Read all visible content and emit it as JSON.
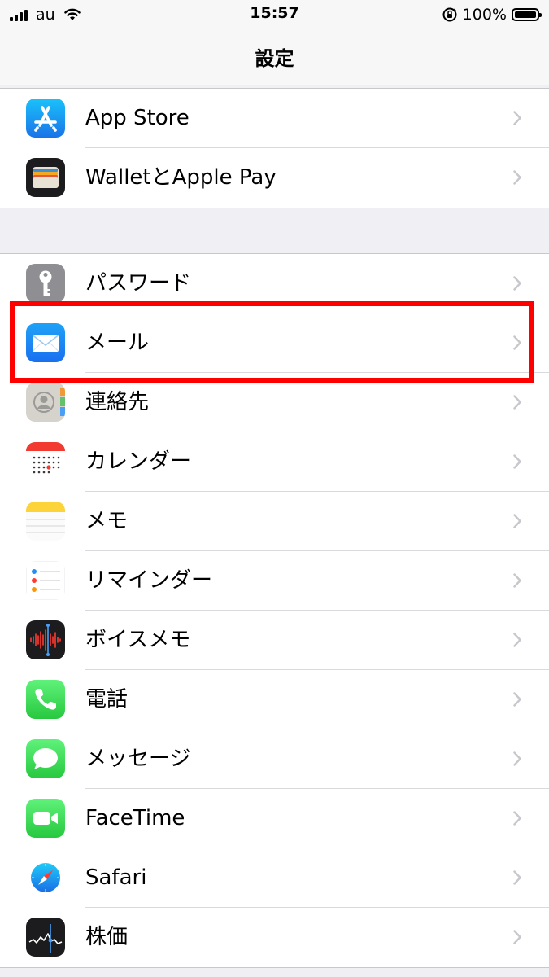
{
  "status_bar": {
    "carrier": "au",
    "time": "15:57",
    "battery_percent": "100%"
  },
  "nav": {
    "title": "設定"
  },
  "groups": [
    {
      "items": [
        {
          "label": "App Store",
          "icon": "app-store-icon"
        },
        {
          "label": "WalletとApple Pay",
          "icon": "wallet-icon"
        }
      ]
    },
    {
      "items": [
        {
          "label": "パスワード",
          "icon": "key-icon"
        },
        {
          "label": "メール",
          "icon": "mail-icon",
          "highlighted": true
        },
        {
          "label": "連絡先",
          "icon": "contacts-icon"
        },
        {
          "label": "カレンダー",
          "icon": "calendar-icon"
        },
        {
          "label": "メモ",
          "icon": "notes-icon"
        },
        {
          "label": "リマインダー",
          "icon": "reminders-icon"
        },
        {
          "label": "ボイスメモ",
          "icon": "voice-memos-icon"
        },
        {
          "label": "電話",
          "icon": "phone-icon"
        },
        {
          "label": "メッセージ",
          "icon": "messages-icon"
        },
        {
          "label": "FaceTime",
          "icon": "facetime-icon"
        },
        {
          "label": "Safari",
          "icon": "safari-icon"
        },
        {
          "label": "株価",
          "icon": "stocks-icon"
        }
      ]
    }
  ],
  "colors": {
    "highlight": "#ff0000",
    "background": "#efeff4",
    "chevron": "#c7c7cc"
  }
}
